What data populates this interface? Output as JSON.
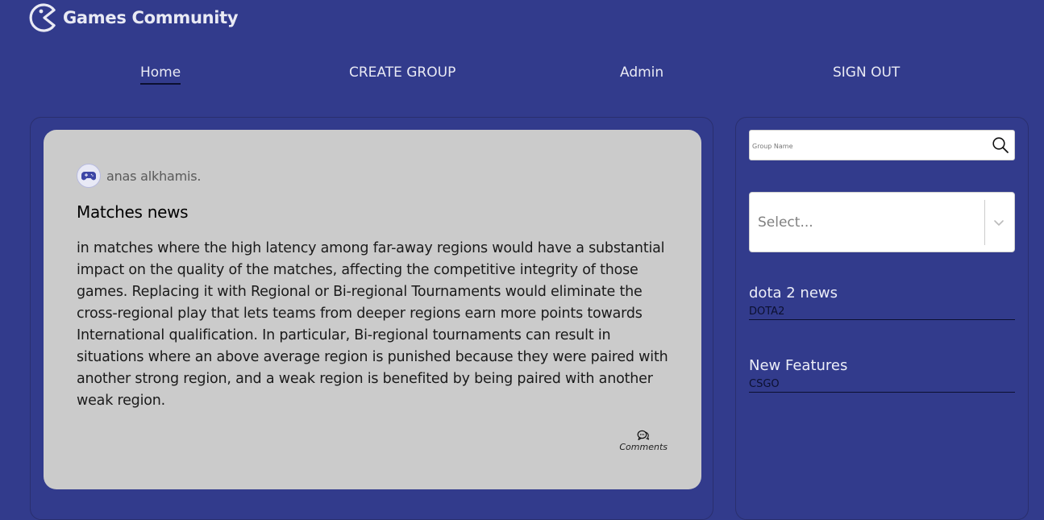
{
  "brand": {
    "name": "Games Community"
  },
  "nav": {
    "items": [
      {
        "label": "Home"
      },
      {
        "label": "CREATE GROUP"
      },
      {
        "label": "Admin"
      },
      {
        "label": "SIGN OUT"
      }
    ],
    "active": "Home"
  },
  "post": {
    "author": "anas alkhamis.",
    "title": "Matches news",
    "body": "in matches where the high latency among far-away regions would have a substantial impact on the quality of the matches, affecting the competitive integrity of those games. Replacing it with Regional or Bi-regional Tournaments would eliminate the cross-regional play that lets teams from deeper regions earn more points towards International qualification. In particular, Bi-regional tournaments can result in situations where an above average region is punished because they were paired with another strong region, and a weak region is benefited by being paired with another weak region.",
    "comments_label": "Comments"
  },
  "sidebar": {
    "search": {
      "placeholder": "Group Name",
      "value": ""
    },
    "select": {
      "value": "Select..."
    },
    "groups": [
      {
        "title": "dota 2 news",
        "tag": "DOTA2"
      },
      {
        "title": "New Features",
        "tag": "CSGO"
      }
    ]
  },
  "colors": {
    "background": "#323b8c",
    "card": "#cbcbcb",
    "text_light": "#e9eaf4",
    "underline": "#0c1030"
  },
  "icons": {
    "logo": "pacman-logo-icon",
    "avatar": "gamepad-icon",
    "comments": "chat-bubbles-icon",
    "search": "search-icon",
    "select": "chevron-down-icon"
  }
}
